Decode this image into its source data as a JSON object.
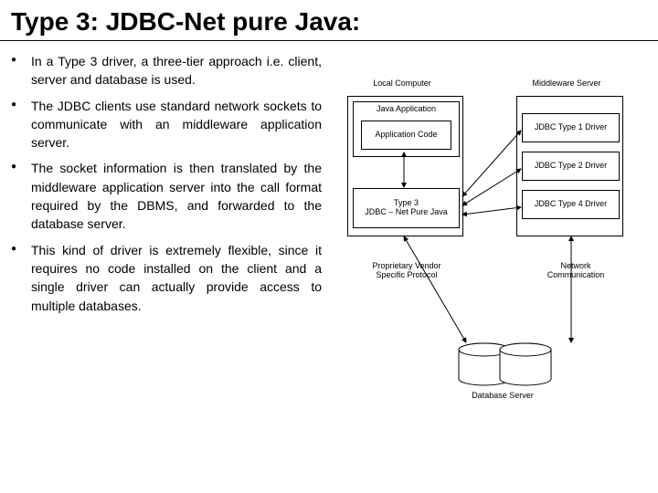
{
  "title": "Type 3: JDBC-Net pure Java:",
  "bullets": [
    "In a Type 3 driver, a three-tier approach i.e. client, server and database is used.",
    "The JDBC clients use standard network sockets to communicate with an middleware application server.",
    "The socket information is then translated by the middleware application server into the call format required by the DBMS, and forwarded to the database server.",
    "This kind of driver is extremely flexible, since it requires no code installed on the client and a single driver can actually provide access to multiple databases."
  ],
  "diagram": {
    "localComputerLabel": "Local Computer",
    "middlewareLabel": "Middleware Server",
    "javaApp": "Java Application",
    "appCode": "Application Code",
    "type3": "Type 3\nJDBC – Net Pure Java",
    "d1": "JDBC Type 1 Driver",
    "d2": "JDBC Type 2 Driver",
    "d4": "JDBC Type 4 Driver",
    "protoLabel": "Proprietary Vendor\nSpecific Protocol",
    "netLabel": "Network\nCommunication",
    "dbServer": "Database Server"
  }
}
